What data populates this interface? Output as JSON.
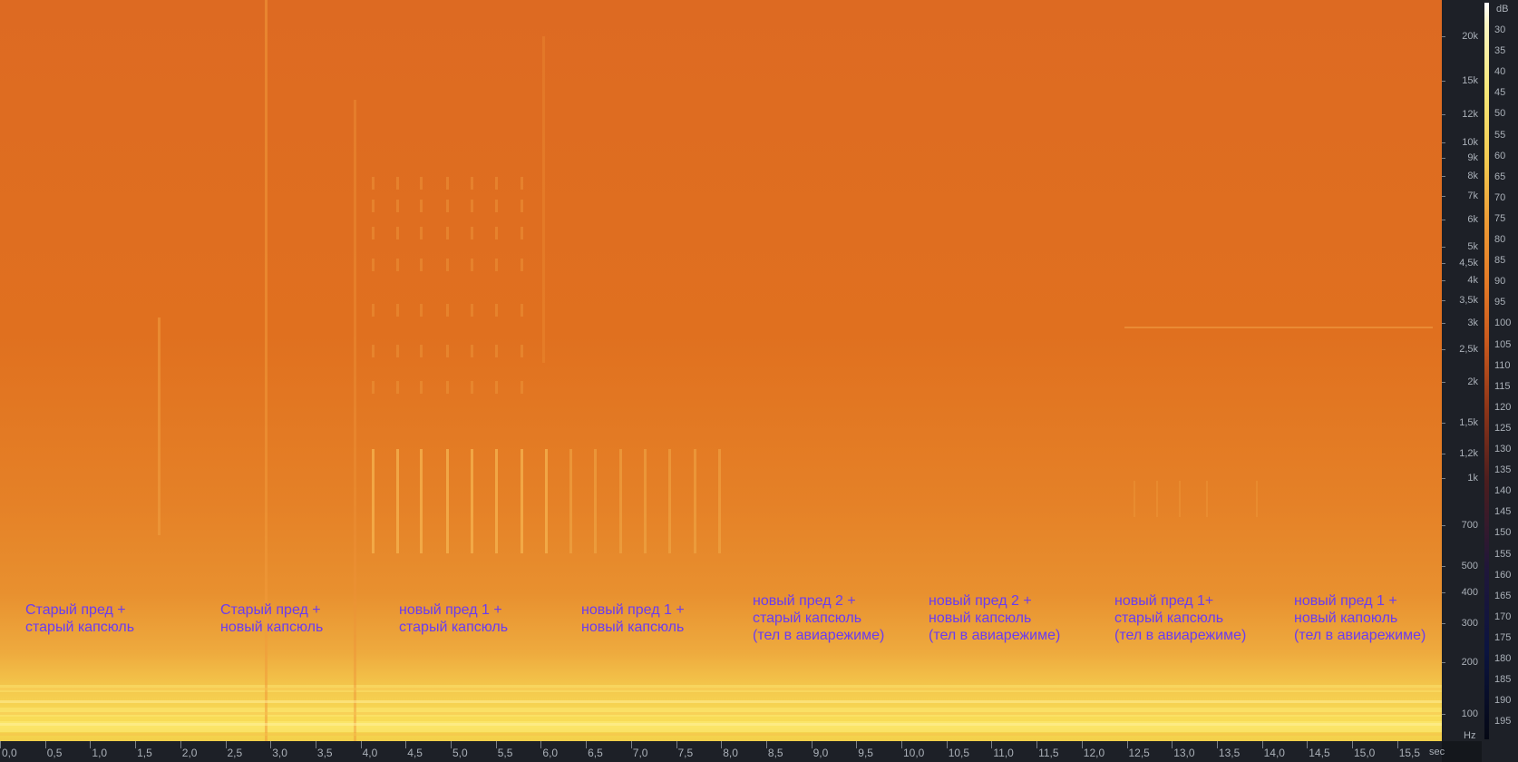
{
  "units": {
    "time": "sec",
    "frequency": "Hz",
    "level": "dB"
  },
  "time_axis": {
    "ticks": [
      "0,0",
      "0,5",
      "1,0",
      "1,5",
      "2,0",
      "2,5",
      "3,0",
      "3,5",
      "4,0",
      "4,5",
      "5,0",
      "5,5",
      "6,0",
      "6,5",
      "7,0",
      "7,5",
      "8,0",
      "8,5",
      "9,0",
      "9,5",
      "10,0",
      "10,5",
      "11,0",
      "11,5",
      "12,0",
      "12,5",
      "13,0",
      "13,5",
      "14,0",
      "14,5",
      "15,0",
      "15,5"
    ]
  },
  "frequency_axis": {
    "ticks": [
      {
        "label": "20k",
        "hz": 20000
      },
      {
        "label": "15k",
        "hz": 15000
      },
      {
        "label": "12k",
        "hz": 12000
      },
      {
        "label": "10k",
        "hz": 10000
      },
      {
        "label": "9k",
        "hz": 9000
      },
      {
        "label": "8k",
        "hz": 8000
      },
      {
        "label": "7k",
        "hz": 7000
      },
      {
        "label": "6k",
        "hz": 6000
      },
      {
        "label": "5k",
        "hz": 5000
      },
      {
        "label": "4,5k",
        "hz": 4500
      },
      {
        "label": "4k",
        "hz": 4000
      },
      {
        "label": "3,5k",
        "hz": 3500
      },
      {
        "label": "3k",
        "hz": 3000
      },
      {
        "label": "2,5k",
        "hz": 2500
      },
      {
        "label": "2k",
        "hz": 2000
      },
      {
        "label": "1,5k",
        "hz": 1500
      },
      {
        "label": "1,2k",
        "hz": 1200
      },
      {
        "label": "1k",
        "hz": 1000
      },
      {
        "label": "700",
        "hz": 700
      },
      {
        "label": "500",
        "hz": 500
      },
      {
        "label": "400",
        "hz": 400
      },
      {
        "label": "300",
        "hz": 300
      },
      {
        "label": "200",
        "hz": 200
      },
      {
        "label": "100",
        "hz": 100
      }
    ]
  },
  "db_scale": {
    "ticks": [
      "30",
      "35",
      "40",
      "45",
      "50",
      "55",
      "60",
      "65",
      "70",
      "75",
      "80",
      "85",
      "90",
      "95",
      "100",
      "105",
      "110",
      "115",
      "120",
      "125",
      "130",
      "135",
      "140",
      "145",
      "150",
      "155",
      "160",
      "165",
      "170",
      "175",
      "180",
      "185",
      "190",
      "195"
    ]
  },
  "annotations": [
    {
      "lines": [
        "Старый пред +",
        "старый капсюль"
      ]
    },
    {
      "lines": [
        "Старый пред +",
        "новый капсюль"
      ]
    },
    {
      "lines": [
        "новый пред 1 +",
        "старый капсюль"
      ]
    },
    {
      "lines": [
        "новый пред 1 +",
        "новый капсюль"
      ]
    },
    {
      "lines": [
        "новый пред 2 +",
        "старый капсюль",
        "(тел в авиарежиме)"
      ]
    },
    {
      "lines": [
        "новый пред 2 +",
        "новый капсюль",
        "(тел в авиарежиме)"
      ]
    },
    {
      "lines": [
        "новый пред 1+",
        "старый капсюль",
        "(тел в авиарежиме)"
      ]
    },
    {
      "lines": [
        "новый пред 1 +",
        "новый капоюль",
        "(тел в авиарежиме)"
      ]
    }
  ],
  "colors": {
    "annotation_text": "#6a3cf0",
    "spectrogram_base": "#e0701f",
    "panel_background": "#1d2027",
    "axis_text": "#aab0b8"
  }
}
